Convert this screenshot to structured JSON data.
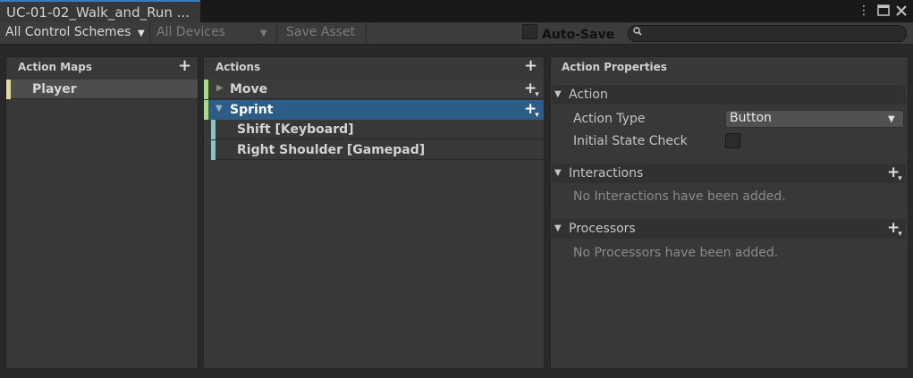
{
  "window": {
    "tab_title": "UC-01-02_Walk_and_Run ...",
    "menu_icon": "kebab-menu-icon",
    "maximize_icon": "maximize-icon",
    "close_icon": "close-icon"
  },
  "toolbar": {
    "control_schemes": "All Control Schemes",
    "devices": "All Devices",
    "save_asset": "Save Asset",
    "auto_save_label": "Auto-Save",
    "auto_save_checked": false,
    "search_placeholder": "",
    "search_icon": "search-icon"
  },
  "action_maps": {
    "header": "Action Maps",
    "items": [
      {
        "label": "Player",
        "color": "#e5d88a"
      }
    ]
  },
  "actions": {
    "header": "Actions",
    "items": [
      {
        "label": "Move",
        "color": "#a6d98c",
        "expanded": false
      },
      {
        "label": "Sprint",
        "color": "#a6d98c",
        "expanded": true,
        "selected": true,
        "bindings": [
          {
            "label": "Shift [Keyboard]",
            "color": "#8ec2c2"
          },
          {
            "label": "Right Shoulder [Gamepad]",
            "color": "#8ec2c2"
          }
        ]
      }
    ]
  },
  "properties": {
    "header": "Action Properties",
    "action_section": {
      "title": "Action",
      "action_type_label": "Action Type",
      "action_type_value": "Button",
      "initial_state_label": "Initial State Check",
      "initial_state_checked": false
    },
    "interactions_section": {
      "title": "Interactions",
      "empty_text": "No Interactions have been added."
    },
    "processors_section": {
      "title": "Processors",
      "empty_text": "No Processors have been added."
    }
  },
  "colors": {
    "selection": "#2c5d87",
    "accent": "#3a79bb"
  }
}
